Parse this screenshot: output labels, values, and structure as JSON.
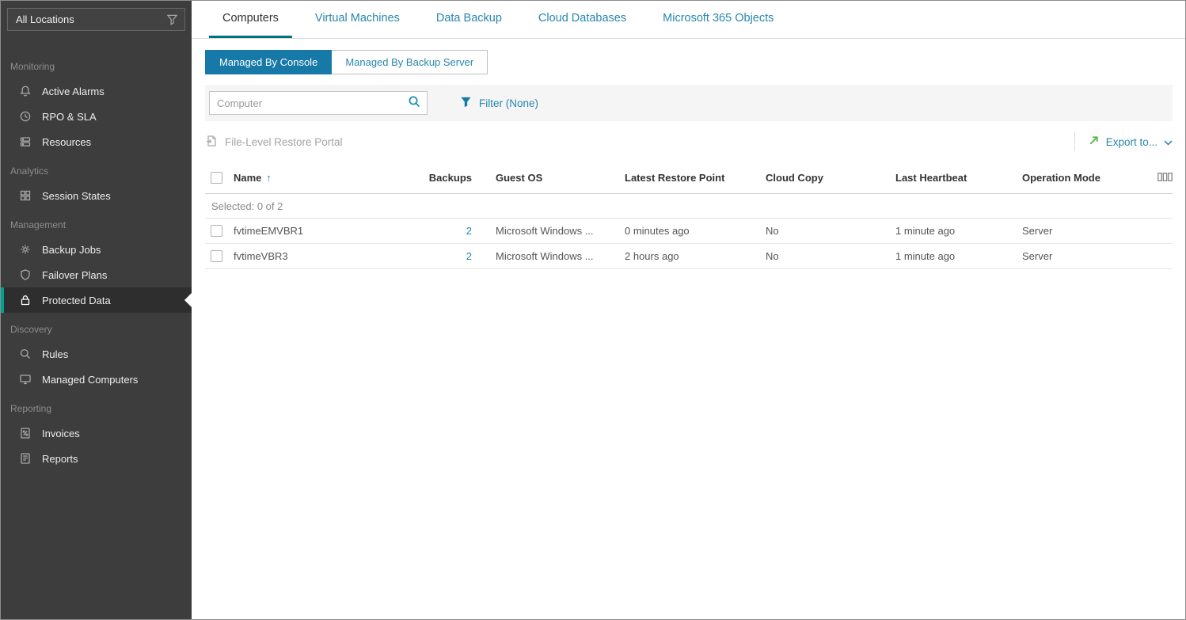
{
  "colors": {
    "accent_teal": "#1779a8",
    "link_teal": "#2787ad",
    "active_tab_underline": "#00737f",
    "sidebar_bg": "#3d3d3d",
    "sidebar_selected_stripe": "#00a28f",
    "export_green": "#54b948"
  },
  "sidebar": {
    "location_filter": "All Locations",
    "sections": [
      {
        "label": "Monitoring",
        "items": [
          {
            "label": "Active Alarms"
          },
          {
            "label": "RPO & SLA"
          },
          {
            "label": "Resources"
          }
        ]
      },
      {
        "label": "Analytics",
        "items": [
          {
            "label": "Session States"
          }
        ]
      },
      {
        "label": "Management",
        "items": [
          {
            "label": "Backup Jobs"
          },
          {
            "label": "Failover Plans"
          },
          {
            "label": "Protected Data"
          }
        ]
      },
      {
        "label": "Discovery",
        "items": [
          {
            "label": "Rules"
          },
          {
            "label": "Managed Computers"
          }
        ]
      },
      {
        "label": "Reporting",
        "items": [
          {
            "label": "Invoices"
          },
          {
            "label": "Reports"
          }
        ]
      }
    ]
  },
  "tabs": {
    "items": [
      "Computers",
      "Virtual Machines",
      "Data Backup",
      "Cloud Databases",
      "Microsoft 365 Objects"
    ],
    "active": "Computers"
  },
  "subtabs": {
    "items": [
      "Managed By Console",
      "Managed By Backup Server"
    ],
    "active": "Managed By Console"
  },
  "filter_bar": {
    "search_placeholder": "Computer",
    "filter_label": "Filter (None)"
  },
  "toolbar": {
    "flr_label": "File-Level Restore Portal",
    "export_label": "Export to..."
  },
  "table": {
    "headers": {
      "name": "Name",
      "backups": "Backups",
      "guest_os": "Guest OS",
      "latest_restore_point": "Latest Restore Point",
      "cloud_copy": "Cloud Copy",
      "last_heartbeat": "Last Heartbeat",
      "operation_mode": "Operation Mode"
    },
    "selected_summary": "Selected: 0 of 2",
    "rows": [
      {
        "name": "fvtimeEMVBR1",
        "backups": "2",
        "guest_os": "Microsoft Windows ...",
        "latest_restore_point": "0 minutes ago",
        "cloud_copy": "No",
        "last_heartbeat": "1 minute ago",
        "operation_mode": "Server"
      },
      {
        "name": "fvtimeVBR3",
        "backups": "2",
        "guest_os": "Microsoft Windows ...",
        "latest_restore_point": "2 hours ago",
        "cloud_copy": "No",
        "last_heartbeat": "1 minute ago",
        "operation_mode": "Server"
      }
    ]
  }
}
